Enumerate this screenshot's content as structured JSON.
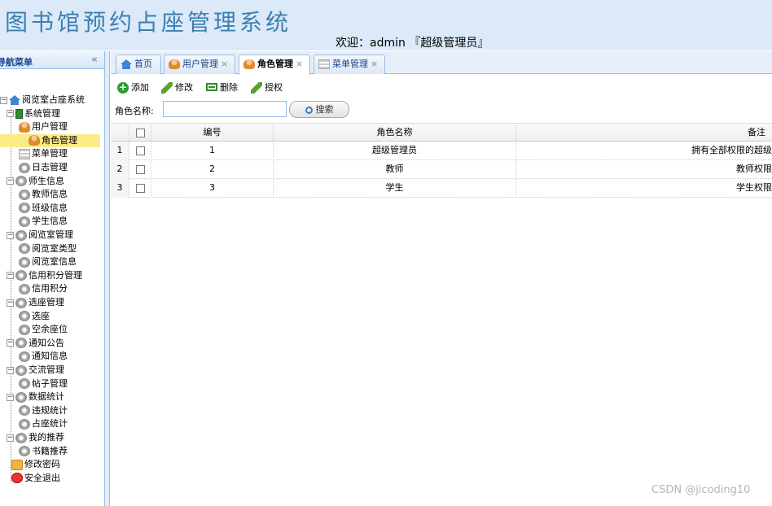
{
  "header": {
    "app_title": "图书馆预约占座管理系统",
    "welcome": "欢迎：admin 『超级管理员』"
  },
  "sidebar": {
    "title": "导航菜单",
    "collapse_glyph": "«",
    "items": [
      {
        "label": "阅览室占座系统",
        "icon": "home-icon"
      },
      {
        "label": "系统管理",
        "icon": "book-icon"
      },
      {
        "label": "用户管理",
        "icon": "user-icon"
      },
      {
        "label": "角色管理",
        "icon": "users-icon",
        "selected": true
      },
      {
        "label": "菜单管理",
        "icon": "menu-icon"
      },
      {
        "label": "日志管理",
        "icon": "gear-icon"
      },
      {
        "label": "师生信息",
        "icon": "gear-icon"
      },
      {
        "label": "教师信息",
        "icon": "gear-icon"
      },
      {
        "label": "班级信息",
        "icon": "gear-icon"
      },
      {
        "label": "学生信息",
        "icon": "gear-icon"
      },
      {
        "label": "阅览室管理",
        "icon": "gear-icon"
      },
      {
        "label": "阅览室类型",
        "icon": "gear-icon"
      },
      {
        "label": "阅览室信息",
        "icon": "gear-icon"
      },
      {
        "label": "信用积分管理",
        "icon": "gear-icon"
      },
      {
        "label": "信用积分",
        "icon": "gear-icon"
      },
      {
        "label": "选座管理",
        "icon": "gear-icon"
      },
      {
        "label": "选座",
        "icon": "gear-icon"
      },
      {
        "label": "空余座位",
        "icon": "gear-icon"
      },
      {
        "label": "通知公告",
        "icon": "gear-icon"
      },
      {
        "label": "通知信息",
        "icon": "gear-icon"
      },
      {
        "label": "交流管理",
        "icon": "gear-icon"
      },
      {
        "label": "帖子管理",
        "icon": "gear-icon"
      },
      {
        "label": "数据统计",
        "icon": "gear-icon"
      },
      {
        "label": "违规统计",
        "icon": "gear-icon"
      },
      {
        "label": "占座统计",
        "icon": "gear-icon"
      },
      {
        "label": "我的推荐",
        "icon": "gear-icon"
      },
      {
        "label": "书籍推荐",
        "icon": "gear-icon"
      },
      {
        "label": "修改密码",
        "icon": "key-icon"
      },
      {
        "label": "安全退出",
        "icon": "exit-icon"
      }
    ]
  },
  "tabs": [
    {
      "label": "首页",
      "closable": false
    },
    {
      "label": "用户管理",
      "closable": true
    },
    {
      "label": "角色管理",
      "closable": true,
      "active": true
    },
    {
      "label": "菜单管理",
      "closable": true
    }
  ],
  "tab_close_glyph": "×",
  "toolbar": {
    "add": "添加",
    "edit": "修改",
    "delete": "删除",
    "authorize": "授权"
  },
  "search": {
    "label": "角色名称:",
    "value": "",
    "placeholder": "",
    "button": "搜索"
  },
  "grid": {
    "columns": [
      "编号",
      "角色名称",
      "备注"
    ],
    "rows": [
      {
        "num": "1",
        "id": "1",
        "name": "超级管理员",
        "remark": "拥有全部权限的超级"
      },
      {
        "num": "2",
        "id": "2",
        "name": "教师",
        "remark": "教师权限"
      },
      {
        "num": "3",
        "id": "3",
        "name": "学生",
        "remark": "学生权限"
      }
    ]
  },
  "watermark": "CSDN @jicoding10",
  "colors": {
    "header_bg": "#dbe9f8",
    "title": "#3c7fb1",
    "border": "#99bbe8",
    "selected_bg": "#fbec88"
  }
}
